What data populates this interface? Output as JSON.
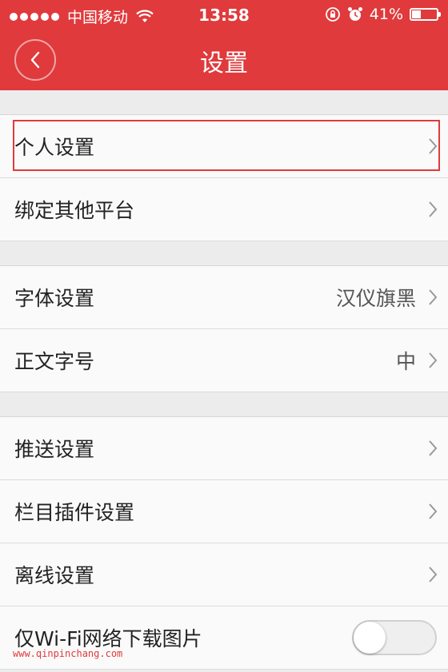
{
  "status_bar": {
    "carrier": "中国移动",
    "time": "13:58",
    "battery": "41%",
    "battery_level": 0.41,
    "icons": [
      "signal-dots-icon",
      "wifi-icon",
      "rotation-lock-icon",
      "alarm-icon",
      "battery-icon"
    ]
  },
  "navbar": {
    "title": "设置",
    "back_icon": "chevron-left-icon"
  },
  "groups": [
    [
      {
        "label": "个人设置",
        "value": ""
      },
      {
        "label": "绑定其他平台",
        "value": ""
      }
    ],
    [
      {
        "label": "字体设置",
        "value": "汉仪旗黑"
      },
      {
        "label": "正文字号",
        "value": "中"
      }
    ],
    [
      {
        "label": "推送设置",
        "value": ""
      },
      {
        "label": "栏目插件设置",
        "value": ""
      },
      {
        "label": "离线设置",
        "value": ""
      },
      {
        "label": "仅Wi-Fi网络下载图片",
        "toggle": false
      }
    ]
  ],
  "watermark": "www.qinpinchang.com",
  "colors": {
    "accent": "#e03a3c",
    "background": "#ececec",
    "row": "#fafafa"
  }
}
